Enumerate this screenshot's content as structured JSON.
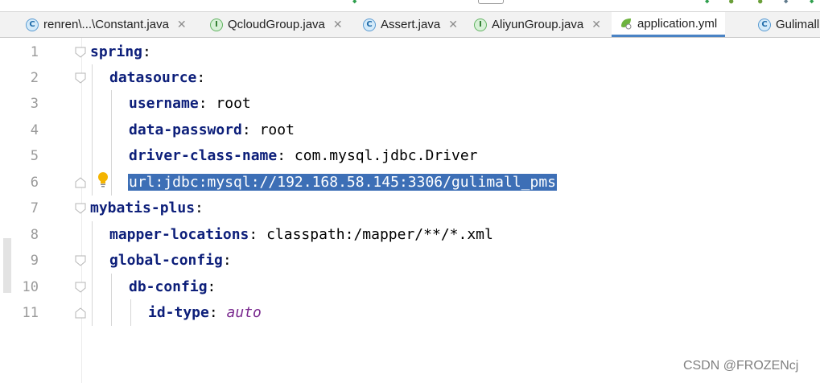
{
  "tabs": [
    {
      "label": "renren\\...\\Constant.java",
      "icon": "java-class-icon",
      "icon_glyph": "C",
      "active": false
    },
    {
      "label": "QcloudGroup.java",
      "icon": "java-interface-icon",
      "icon_glyph": "I",
      "active": false
    },
    {
      "label": "Assert.java",
      "icon": "java-class-icon",
      "icon_glyph": "C",
      "active": false
    },
    {
      "label": "AliyunGroup.java",
      "icon": "java-interface-icon",
      "icon_glyph": "I",
      "active": false
    },
    {
      "label": "application.yml",
      "icon": "spring-yml-icon",
      "icon_glyph": "",
      "active": true
    },
    {
      "label": "Gulimall",
      "icon": "java-class-icon",
      "icon_glyph": "C",
      "active": false
    }
  ],
  "close_glyph": "✕",
  "editor": {
    "line_numbers": [
      "1",
      "2",
      "3",
      "4",
      "5",
      "6",
      "7",
      "8",
      "9",
      "10",
      "11"
    ],
    "lines": [
      {
        "key": "spring",
        "sep": ":",
        "value": ""
      },
      {
        "key": "datasource",
        "sep": ":",
        "value": ""
      },
      {
        "key": "username",
        "sep": ": ",
        "value": "root"
      },
      {
        "key": "data-password",
        "sep": ": ",
        "value": "root"
      },
      {
        "key": "driver-class-name",
        "sep": ": ",
        "value": "com.mysql.jdbc.Driver"
      },
      {
        "selected_text": "url:jdbc:mysql://192.168.58.145:3306/gulimall_pms"
      },
      {
        "key": "mybatis-plus",
        "sep": ":",
        "value": ""
      },
      {
        "key": "mapper-locations",
        "sep": ": ",
        "value": "classpath:/mapper/**/*.xml"
      },
      {
        "key": "global-config",
        "sep": ":",
        "value": ""
      },
      {
        "key": "db-config",
        "sep": ":",
        "value": ""
      },
      {
        "key": "id-type",
        "sep": ": ",
        "value": "auto"
      }
    ]
  },
  "colors": {
    "selection": "#3d6fb6",
    "key": "#0d1f7a",
    "enum_value": "#7a2a8f",
    "tab_active_underline": "#4a83c4"
  },
  "watermark": "CSDN @FROZENcj"
}
